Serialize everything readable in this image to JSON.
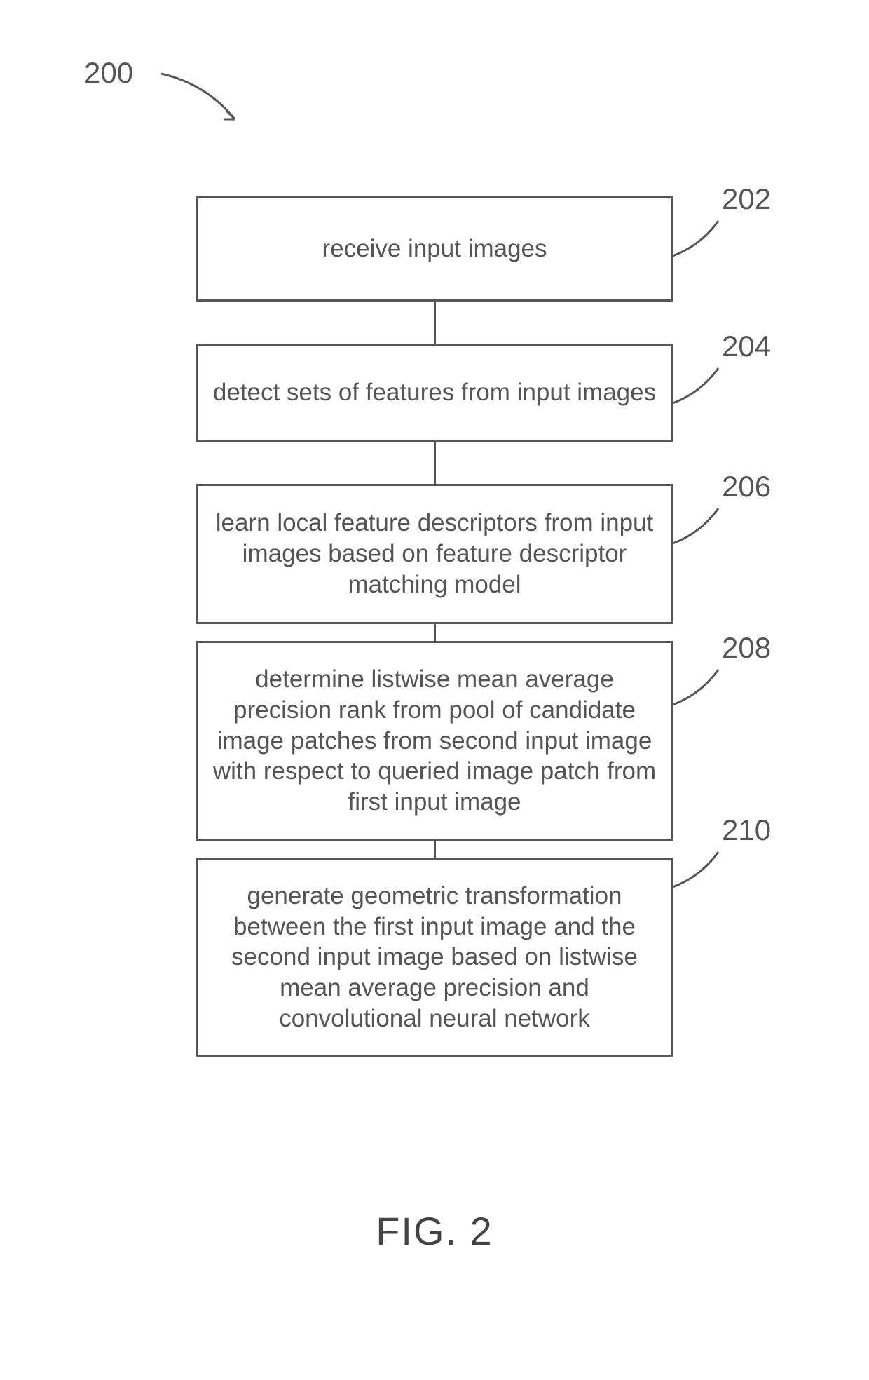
{
  "figure_ref": "200",
  "figure_caption": "FIG. 2",
  "steps": [
    {
      "ref": "202",
      "text": "receive input images"
    },
    {
      "ref": "204",
      "text": "detect sets of features from input images"
    },
    {
      "ref": "206",
      "text": "learn local feature descriptors from input images based on feature descriptor matching model"
    },
    {
      "ref": "208",
      "text": "determine listwise mean average precision rank from pool of candidate image patches from second input image with respect to queried image patch from first input image"
    },
    {
      "ref": "210",
      "text": "generate geometric transformation between the first input image and the second input image based on listwise mean average precision and convolutional neural network"
    }
  ]
}
